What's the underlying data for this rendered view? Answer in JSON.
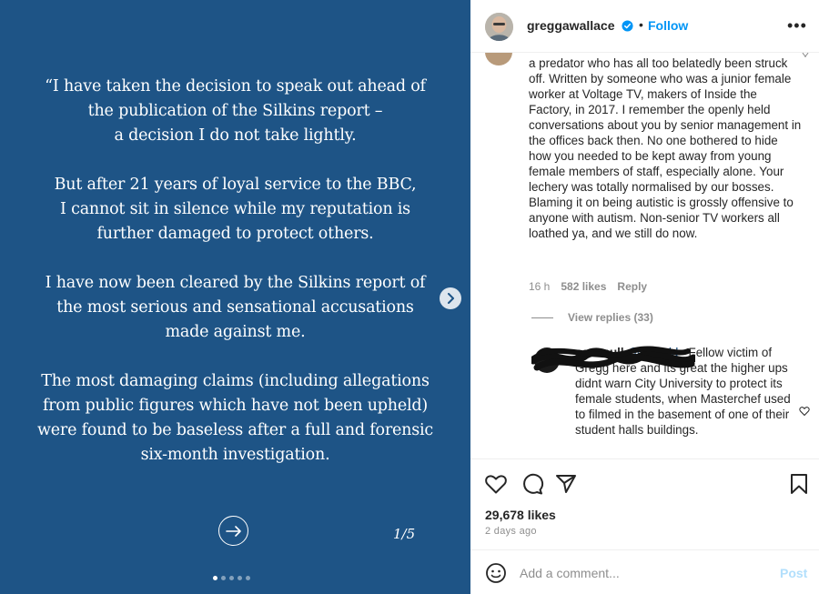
{
  "media": {
    "paragraphs": [
      [
        "“I have taken the decision to speak out ahead of",
        "the publication of the Silkins report –",
        "a decision I do not take lightly."
      ],
      [
        "But after 21 years of loyal service to the BBC,",
        "I cannot sit in silence while my reputation is",
        "further damaged to protect others."
      ],
      [
        "I have now been cleared by the Silkins report of",
        "the most serious and sensational accusations",
        "made against me."
      ],
      [
        "The most damaging claims (including allegations",
        "from public figures which have not been upheld)",
        "were found to be baseless after a full and forensic",
        "six-month investigation."
      ]
    ],
    "page_indicator": "1/5",
    "background_color": "#1e5486"
  },
  "header": {
    "username": "greggawallace",
    "separator": "•",
    "follow_label": "Follow",
    "more_label": "•••"
  },
  "comment": {
    "text": "a predator who has all too belatedly been struck off. Written by someone who was a junior female worker at Voltage TV, makers of Inside the Factory, in 2017. I remember the openly held conversations about you by senior management in the offices back then. No one bothered to hide how you needed to be kept away from young female members of staff, especially alone. Your lechery was totally normalised by our bosses. Blaming it on being autistic is grossly offensive to anyone with autism. Non-senior TV workers all loathed ya, and we still do now.",
    "time": "16 h",
    "likes": "582 likes",
    "reply_label": "Reply",
    "view_replies": "View replies (33)"
  },
  "reply": {
    "username": "sas.mull",
    "mention": "@katy_ld_",
    "text": "Fellow victim of Gregg here and its great the higher ups didnt warn City University to protect its female students, when Masterchef used to filmed in the basement of one of their student halls buildings."
  },
  "actions": {
    "likes": "29,678 likes",
    "date": "2 days ago"
  },
  "add_comment": {
    "placeholder": "Add a comment...",
    "post_label": "Post"
  },
  "colors": {
    "accent": "#0095f6",
    "verified": "#0095f6",
    "muted": "#8e8e8e"
  }
}
